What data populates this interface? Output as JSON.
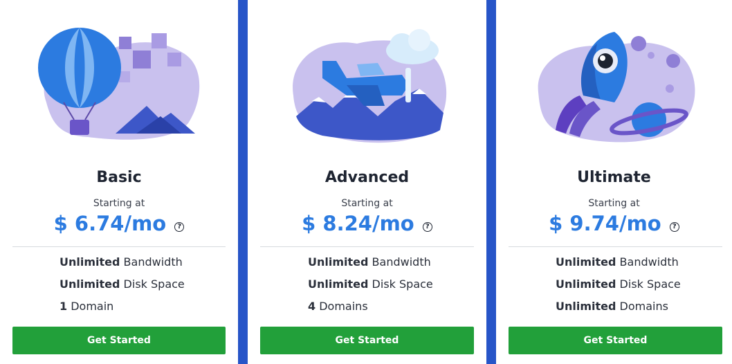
{
  "plans": [
    {
      "name": "Basic",
      "starting_label": "Starting at",
      "price": "$ 6.74/mo",
      "help_glyph": "?",
      "features": [
        {
          "bold": "Unlimited",
          "text": " Bandwidth"
        },
        {
          "bold": "Unlimited",
          "text": " Disk Space"
        },
        {
          "bold": "1",
          "text": " Domain"
        }
      ],
      "cta_label": "Get Started",
      "illustration": "hot-air-balloon-icon"
    },
    {
      "name": "Advanced",
      "starting_label": "Starting at",
      "price": "$ 8.24/mo",
      "help_glyph": "?",
      "features": [
        {
          "bold": "Unlimited",
          "text": " Bandwidth"
        },
        {
          "bold": "Unlimited",
          "text": " Disk Space"
        },
        {
          "bold": "4",
          "text": " Domains"
        }
      ],
      "cta_label": "Get Started",
      "illustration": "airplane-icon"
    },
    {
      "name": "Ultimate",
      "starting_label": "Starting at",
      "price": "$ 9.74/mo",
      "help_glyph": "?",
      "features": [
        {
          "bold": "Unlimited",
          "text": " Bandwidth"
        },
        {
          "bold": "Unlimited",
          "text": " Disk Space"
        },
        {
          "bold": "Unlimited",
          "text": " Domains"
        }
      ],
      "cta_label": "Get Started",
      "illustration": "rocket-icon"
    }
  ],
  "colors": {
    "price": "#2c7be0",
    "cta": "#22a03a",
    "stripe": "#2755c8",
    "blob": "#c9c1ee"
  }
}
